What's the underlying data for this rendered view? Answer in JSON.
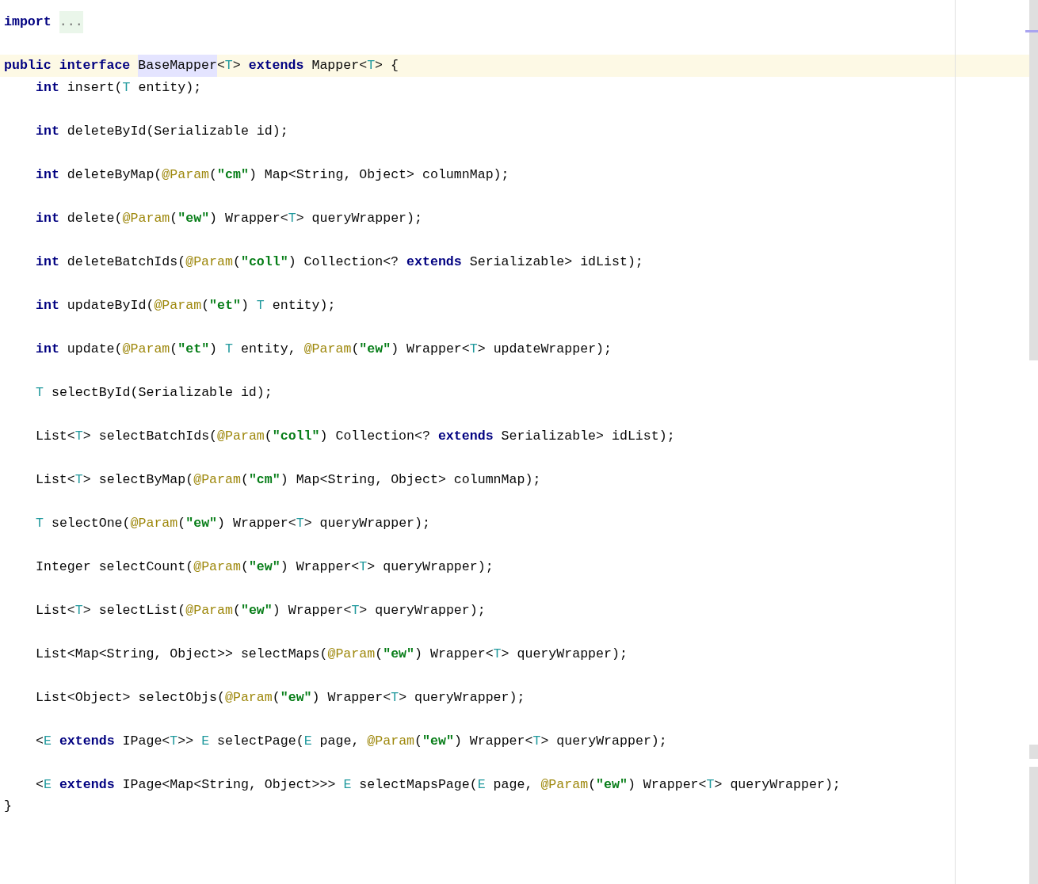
{
  "editor": {
    "lines": [
      {
        "kind": "import",
        "current": false,
        "tokens": [
          {
            "kind": "kw",
            "t": "import "
          },
          {
            "kind": "fold",
            "t": "..."
          }
        ]
      },
      {
        "kind": "header",
        "current": true,
        "tokens": [
          {
            "kind": "kw",
            "t": "public interface "
          },
          {
            "kind": "hl",
            "t": "BaseMapper"
          },
          {
            "kind": "plain",
            "t": "<"
          },
          {
            "kind": "tp",
            "t": "T"
          },
          {
            "kind": "plain",
            "t": "> "
          },
          {
            "kind": "kw",
            "t": "extends"
          },
          {
            "kind": "plain",
            "t": " Mapper<"
          },
          {
            "kind": "tp",
            "t": "T"
          },
          {
            "kind": "plain",
            "t": "> {"
          }
        ]
      },
      {
        "kind": "method",
        "current": false,
        "tokens": [
          {
            "kind": "kw",
            "t": "int"
          },
          {
            "kind": "plain",
            "t": " insert("
          },
          {
            "kind": "tp",
            "t": "T"
          },
          {
            "kind": "plain",
            "t": " entity);"
          }
        ]
      },
      {
        "kind": "method",
        "current": false,
        "tokens": [
          {
            "kind": "kw",
            "t": "int"
          },
          {
            "kind": "plain",
            "t": " deleteById(Serializable id);"
          }
        ]
      },
      {
        "kind": "method",
        "current": false,
        "tokens": [
          {
            "kind": "kw",
            "t": "int"
          },
          {
            "kind": "plain",
            "t": " deleteByMap("
          },
          {
            "kind": "ann",
            "t": "@Param"
          },
          {
            "kind": "plain",
            "t": "("
          },
          {
            "kind": "str",
            "t": "\"cm\""
          },
          {
            "kind": "plain",
            "t": ") Map<String, Object> columnMap);"
          }
        ]
      },
      {
        "kind": "method",
        "current": false,
        "tokens": [
          {
            "kind": "kw",
            "t": "int"
          },
          {
            "kind": "plain",
            "t": " delete("
          },
          {
            "kind": "ann",
            "t": "@Param"
          },
          {
            "kind": "plain",
            "t": "("
          },
          {
            "kind": "str",
            "t": "\"ew\""
          },
          {
            "kind": "plain",
            "t": ") Wrapper<"
          },
          {
            "kind": "tp",
            "t": "T"
          },
          {
            "kind": "plain",
            "t": "> queryWrapper);"
          }
        ]
      },
      {
        "kind": "method",
        "current": false,
        "tokens": [
          {
            "kind": "kw",
            "t": "int"
          },
          {
            "kind": "plain",
            "t": " deleteBatchIds("
          },
          {
            "kind": "ann",
            "t": "@Param"
          },
          {
            "kind": "plain",
            "t": "("
          },
          {
            "kind": "str",
            "t": "\"coll\""
          },
          {
            "kind": "plain",
            "t": ") Collection<? "
          },
          {
            "kind": "kw",
            "t": "extends"
          },
          {
            "kind": "plain",
            "t": " Serializable> idList);"
          }
        ]
      },
      {
        "kind": "method",
        "current": false,
        "tokens": [
          {
            "kind": "kw",
            "t": "int"
          },
          {
            "kind": "plain",
            "t": " updateById("
          },
          {
            "kind": "ann",
            "t": "@Param"
          },
          {
            "kind": "plain",
            "t": "("
          },
          {
            "kind": "str",
            "t": "\"et\""
          },
          {
            "kind": "plain",
            "t": ") "
          },
          {
            "kind": "tp",
            "t": "T"
          },
          {
            "kind": "plain",
            "t": " entity);"
          }
        ]
      },
      {
        "kind": "method",
        "current": false,
        "tokens": [
          {
            "kind": "kw",
            "t": "int"
          },
          {
            "kind": "plain",
            "t": " update("
          },
          {
            "kind": "ann",
            "t": "@Param"
          },
          {
            "kind": "plain",
            "t": "("
          },
          {
            "kind": "str",
            "t": "\"et\""
          },
          {
            "kind": "plain",
            "t": ") "
          },
          {
            "kind": "tp",
            "t": "T"
          },
          {
            "kind": "plain",
            "t": " entity, "
          },
          {
            "kind": "ann",
            "t": "@Param"
          },
          {
            "kind": "plain",
            "t": "("
          },
          {
            "kind": "str",
            "t": "\"ew\""
          },
          {
            "kind": "plain",
            "t": ") Wrapper<"
          },
          {
            "kind": "tp",
            "t": "T"
          },
          {
            "kind": "plain",
            "t": "> updateWrapper);"
          }
        ]
      },
      {
        "kind": "method",
        "current": false,
        "tokens": [
          {
            "kind": "tp",
            "t": "T"
          },
          {
            "kind": "plain",
            "t": " selectById(Serializable id);"
          }
        ]
      },
      {
        "kind": "method",
        "current": false,
        "tokens": [
          {
            "kind": "plain",
            "t": "List<"
          },
          {
            "kind": "tp",
            "t": "T"
          },
          {
            "kind": "plain",
            "t": "> selectBatchIds("
          },
          {
            "kind": "ann",
            "t": "@Param"
          },
          {
            "kind": "plain",
            "t": "("
          },
          {
            "kind": "str",
            "t": "\"coll\""
          },
          {
            "kind": "plain",
            "t": ") Collection<? "
          },
          {
            "kind": "kw",
            "t": "extends"
          },
          {
            "kind": "plain",
            "t": " Serializable> idList);"
          }
        ]
      },
      {
        "kind": "method",
        "current": false,
        "tokens": [
          {
            "kind": "plain",
            "t": "List<"
          },
          {
            "kind": "tp",
            "t": "T"
          },
          {
            "kind": "plain",
            "t": "> selectByMap("
          },
          {
            "kind": "ann",
            "t": "@Param"
          },
          {
            "kind": "plain",
            "t": "("
          },
          {
            "kind": "str",
            "t": "\"cm\""
          },
          {
            "kind": "plain",
            "t": ") Map<String, Object> columnMap);"
          }
        ]
      },
      {
        "kind": "method",
        "current": false,
        "tokens": [
          {
            "kind": "tp",
            "t": "T"
          },
          {
            "kind": "plain",
            "t": " selectOne("
          },
          {
            "kind": "ann",
            "t": "@Param"
          },
          {
            "kind": "plain",
            "t": "("
          },
          {
            "kind": "str",
            "t": "\"ew\""
          },
          {
            "kind": "plain",
            "t": ") Wrapper<"
          },
          {
            "kind": "tp",
            "t": "T"
          },
          {
            "kind": "plain",
            "t": "> queryWrapper);"
          }
        ]
      },
      {
        "kind": "method",
        "current": false,
        "tokens": [
          {
            "kind": "plain",
            "t": "Integer selectCount("
          },
          {
            "kind": "ann",
            "t": "@Param"
          },
          {
            "kind": "plain",
            "t": "("
          },
          {
            "kind": "str",
            "t": "\"ew\""
          },
          {
            "kind": "plain",
            "t": ") Wrapper<"
          },
          {
            "kind": "tp",
            "t": "T"
          },
          {
            "kind": "plain",
            "t": "> queryWrapper);"
          }
        ]
      },
      {
        "kind": "method",
        "current": false,
        "tokens": [
          {
            "kind": "plain",
            "t": "List<"
          },
          {
            "kind": "tp",
            "t": "T"
          },
          {
            "kind": "plain",
            "t": "> selectList("
          },
          {
            "kind": "ann",
            "t": "@Param"
          },
          {
            "kind": "plain",
            "t": "("
          },
          {
            "kind": "str",
            "t": "\"ew\""
          },
          {
            "kind": "plain",
            "t": ") Wrapper<"
          },
          {
            "kind": "tp",
            "t": "T"
          },
          {
            "kind": "plain",
            "t": "> queryWrapper);"
          }
        ]
      },
      {
        "kind": "method",
        "current": false,
        "tokens": [
          {
            "kind": "plain",
            "t": "List<Map<String, Object>> selectMaps("
          },
          {
            "kind": "ann",
            "t": "@Param"
          },
          {
            "kind": "plain",
            "t": "("
          },
          {
            "kind": "str",
            "t": "\"ew\""
          },
          {
            "kind": "plain",
            "t": ") Wrapper<"
          },
          {
            "kind": "tp",
            "t": "T"
          },
          {
            "kind": "plain",
            "t": "> queryWrapper);"
          }
        ]
      },
      {
        "kind": "method",
        "current": false,
        "tokens": [
          {
            "kind": "plain",
            "t": "List<Object> selectObjs("
          },
          {
            "kind": "ann",
            "t": "@Param"
          },
          {
            "kind": "plain",
            "t": "("
          },
          {
            "kind": "str",
            "t": "\"ew\""
          },
          {
            "kind": "plain",
            "t": ") Wrapper<"
          },
          {
            "kind": "tp",
            "t": "T"
          },
          {
            "kind": "plain",
            "t": "> queryWrapper);"
          }
        ]
      },
      {
        "kind": "method",
        "current": false,
        "tokens": [
          {
            "kind": "plain",
            "t": "<"
          },
          {
            "kind": "tp",
            "t": "E"
          },
          {
            "kind": "kw",
            "t": " extends"
          },
          {
            "kind": "plain",
            "t": " IPage<"
          },
          {
            "kind": "tp",
            "t": "T"
          },
          {
            "kind": "plain",
            "t": ">> "
          },
          {
            "kind": "tp",
            "t": "E"
          },
          {
            "kind": "plain",
            "t": " selectPage("
          },
          {
            "kind": "tp",
            "t": "E"
          },
          {
            "kind": "plain",
            "t": " page, "
          },
          {
            "kind": "ann",
            "t": "@Param"
          },
          {
            "kind": "plain",
            "t": "("
          },
          {
            "kind": "str",
            "t": "\"ew\""
          },
          {
            "kind": "plain",
            "t": ") Wrapper<"
          },
          {
            "kind": "tp",
            "t": "T"
          },
          {
            "kind": "plain",
            "t": "> queryWrapper);"
          }
        ]
      },
      {
        "kind": "method",
        "current": false,
        "tokens": [
          {
            "kind": "plain",
            "t": "<"
          },
          {
            "kind": "tp",
            "t": "E"
          },
          {
            "kind": "kw",
            "t": " extends"
          },
          {
            "kind": "plain",
            "t": " IPage<Map<String, Object>>> "
          },
          {
            "kind": "tp",
            "t": "E"
          },
          {
            "kind": "plain",
            "t": " selectMapsPage("
          },
          {
            "kind": "tp",
            "t": "E"
          },
          {
            "kind": "plain",
            "t": " page, "
          },
          {
            "kind": "ann",
            "t": "@Param"
          },
          {
            "kind": "plain",
            "t": "("
          },
          {
            "kind": "str",
            "t": "\"ew\""
          },
          {
            "kind": "plain",
            "t": ") Wrapper<"
          },
          {
            "kind": "tp",
            "t": "T"
          },
          {
            "kind": "plain",
            "t": "> queryWrapper);"
          }
        ]
      },
      {
        "kind": "close",
        "current": false,
        "tokens": [
          {
            "kind": "plain",
            "t": "}"
          }
        ]
      }
    ]
  }
}
